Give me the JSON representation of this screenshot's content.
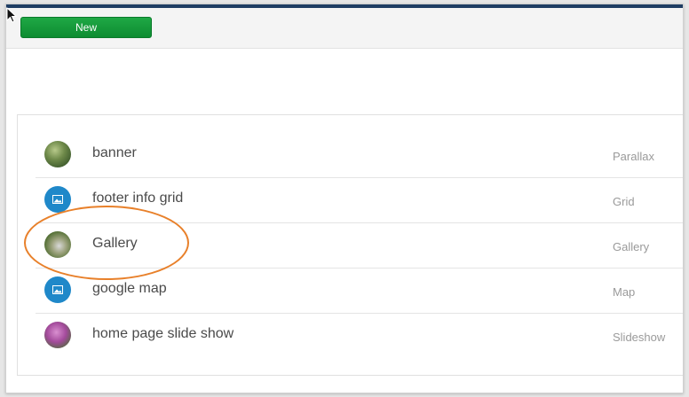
{
  "toolbar": {
    "new_label": "New"
  },
  "list": {
    "items": [
      {
        "title": "banner",
        "type": "Parallax",
        "icon": "photo-thumbnail"
      },
      {
        "title": "footer info grid",
        "type": "Grid",
        "icon": "image-icon"
      },
      {
        "title": "Gallery",
        "type": "Gallery",
        "icon": "photo-thumbnail"
      },
      {
        "title": "google map",
        "type": "Map",
        "icon": "image-icon"
      },
      {
        "title": "home page slide show",
        "type": "Slideshow",
        "icon": "photo-thumbnail"
      }
    ]
  },
  "colors": {
    "top_bar": "#1f3d63",
    "new_button": "#129a3a",
    "icon_blue": "#1f88c9",
    "annotation": "#e8802a"
  }
}
